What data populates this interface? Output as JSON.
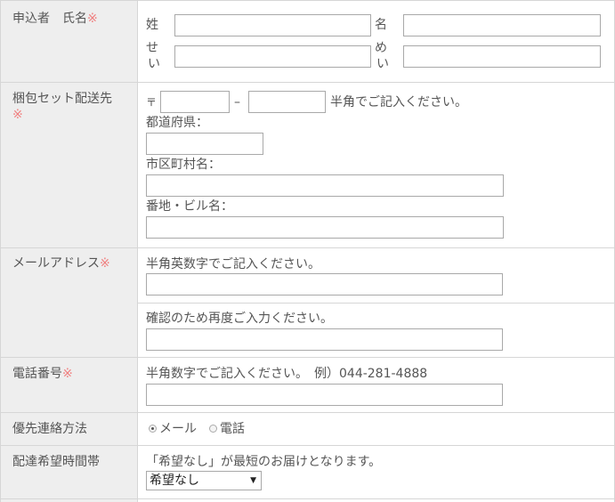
{
  "required_mark": "※",
  "name_row": {
    "label": "申込者　氏名",
    "sei_label": "姓",
    "mei_label": "名",
    "sei_kana_label_1": "せ",
    "sei_kana_label_2": "い",
    "mei_kana_label_1": "め",
    "mei_kana_label_2": "い",
    "sei_value": "",
    "mei_value": "",
    "sei_kana_value": "",
    "mei_kana_value": ""
  },
  "address_row": {
    "label": "梱包セット配送先",
    "postal_mark": "〒",
    "postal_dash": "–",
    "postal_note": "半角でご記入ください。",
    "prefecture_label": "都道府県：",
    "city_label": "市区町村名：",
    "street_label": "番地・ビル名：",
    "postal1_value": "",
    "postal2_value": "",
    "prefecture_value": "",
    "city_value": "",
    "street_value": ""
  },
  "email_row": {
    "label": "メールアドレス",
    "note": "半角英数字でご記入ください。",
    "confirm_note": "確認のため再度ご入力ください。",
    "email_value": "",
    "confirm_value": ""
  },
  "phone_row": {
    "label": "電話番号",
    "note": "半角数字でご記入ください。　例）044-281-4888",
    "phone_value": ""
  },
  "contact_row": {
    "label": "優先連絡方法",
    "options": [
      {
        "label": "メール",
        "selected": true
      },
      {
        "label": "電話",
        "selected": false
      }
    ]
  },
  "delivery_row": {
    "label": "配達希望時間帯",
    "note": "「希望なし」が最短のお届けとなります。",
    "selected_option": "希望なし",
    "arrow": "▼"
  }
}
